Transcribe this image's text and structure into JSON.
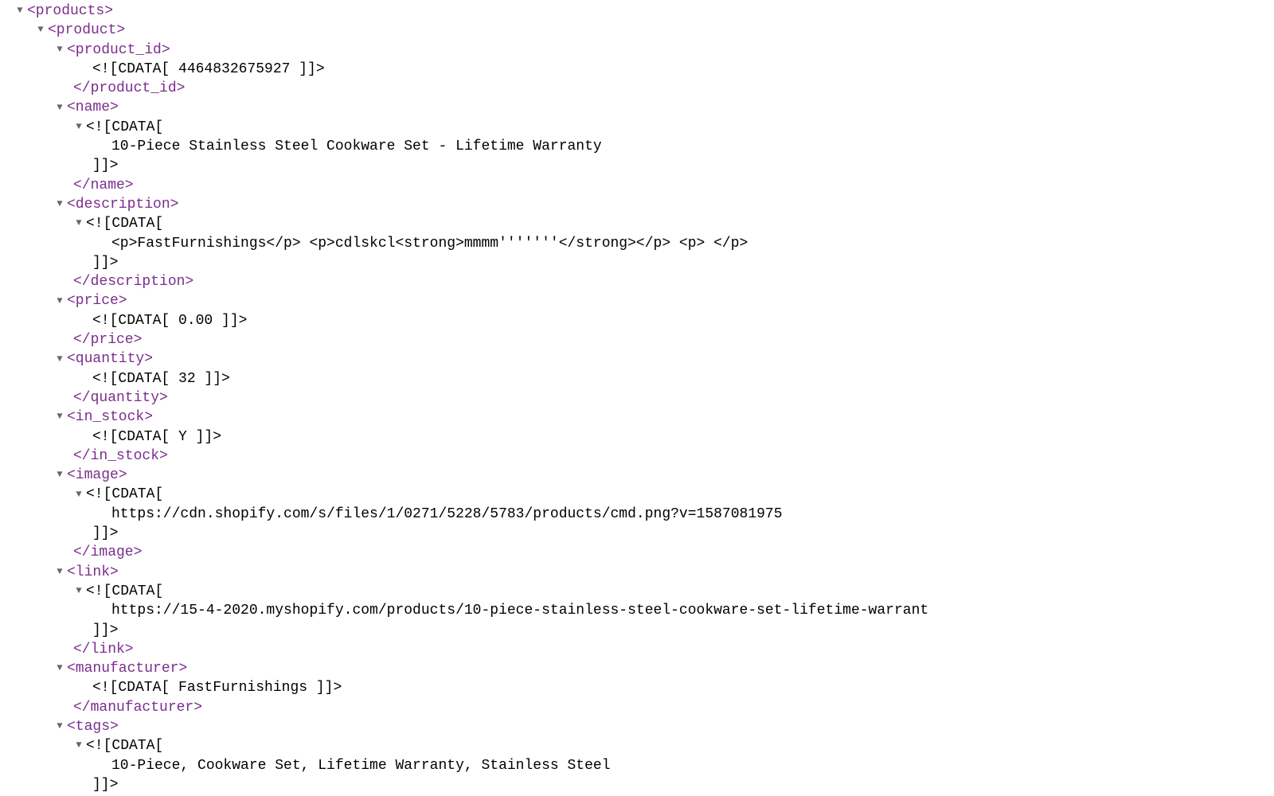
{
  "toggleGlyph": "▼",
  "cdataOpen": "<![CDATA[",
  "cdataClose": "]]>",
  "root": {
    "name": "products",
    "open": "<products>"
  },
  "product": {
    "open": "<product>",
    "product_id": {
      "open": "<product_id>",
      "value": "<![CDATA[ 4464832675927 ]]>",
      "close": "</product_id>"
    },
    "pname": {
      "open": "<name>",
      "value": "10-Piece Stainless Steel Cookware Set - Lifetime Warranty",
      "close": "</name>"
    },
    "description": {
      "open": "<description>",
      "value": "<p>FastFurnishings</p> <p>cdlskcl<strong>mmmm'''''''</strong></p> <p> </p>",
      "close": "</description>"
    },
    "price": {
      "open": "<price>",
      "value": "<![CDATA[ 0.00 ]]>",
      "close": "</price>"
    },
    "quantity": {
      "open": "<quantity>",
      "value": "<![CDATA[ 32 ]]>",
      "close": "</quantity>"
    },
    "in_stock": {
      "open": "<in_stock>",
      "value": "<![CDATA[ Y ]]>",
      "close": "</in_stock>"
    },
    "image": {
      "open": "<image>",
      "value": "https://cdn.shopify.com/s/files/1/0271/5228/5783/products/cmd.png?v=1587081975",
      "close": "</image>"
    },
    "link": {
      "open": "<link>",
      "value": "https://15-4-2020.myshopify.com/products/10-piece-stainless-steel-cookware-set-lifetime-warrant",
      "close": "</link>"
    },
    "manufacturer": {
      "open": "<manufacturer>",
      "value": "<![CDATA[ FastFurnishings ]]>",
      "close": "</manufacturer>"
    },
    "tags": {
      "open": "<tags>",
      "value": "10-Piece, Cookware Set, Lifetime Warranty, Stainless Steel"
    }
  }
}
